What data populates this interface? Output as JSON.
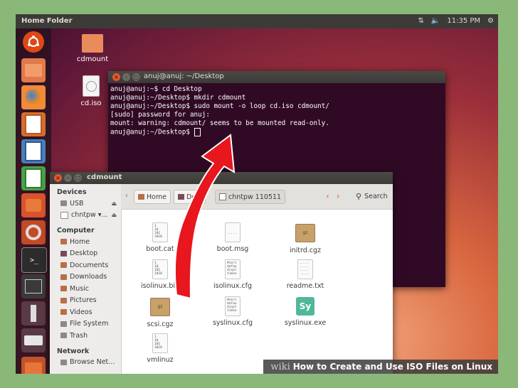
{
  "panel": {
    "title": "Home Folder",
    "clock": "11:35 PM"
  },
  "desktop_icons": [
    {
      "label": "cdmount"
    },
    {
      "label": "cd.iso"
    }
  ],
  "terminal": {
    "title": "anuj@anuj: ~/Desktop",
    "lines": [
      "anuj@anuj:~$ cd Desktop",
      "anuj@anuj:~/Desktop$ mkdir cdmount",
      "anuj@anuj:~/Desktop$ sudo mount -o loop cd.iso cdmount/",
      "[sudo] password for anuj:",
      "mount: warning: cdmount/ seems to be mounted read-only.",
      "anuj@anuj:~/Desktop$ "
    ]
  },
  "files_window": {
    "title": "cdmount",
    "sidebar": {
      "devices_heading": "Devices",
      "devices": [
        "USB",
        "chntpw ▾..."
      ],
      "computer_heading": "Computer",
      "computer": [
        "Home",
        "Desktop",
        "Documents",
        "Downloads",
        "Music",
        "Pictures",
        "Videos",
        "File System",
        "Trash"
      ],
      "network_heading": "Network",
      "network": [
        "Browse Net..."
      ]
    },
    "breadcrumbs": [
      "Home",
      "Desl",
      "chntpw 110511"
    ],
    "search_label": "Search",
    "files": [
      {
        "name": "boot.cat",
        "kind": "doc",
        "glyph": "1\n10\n101\n1010"
      },
      {
        "name": "boot.msg",
        "kind": "doc",
        "glyph": "\n\n.....\n"
      },
      {
        "name": "initrd.cgz",
        "kind": "box",
        "glyph": "gz"
      },
      {
        "name": "isolinux.bin",
        "kind": "doc",
        "glyph": "1\n10\n101\n1010"
      },
      {
        "name": "isolinux.cfg",
        "kind": "doc",
        "glyph": "#seri\ndefau\ndispl\ntimeo"
      },
      {
        "name": "readme.txt",
        "kind": "doc",
        "glyph": ".....\n.....\n.....\n....."
      },
      {
        "name": "scsi.cgz",
        "kind": "box",
        "glyph": "gz"
      },
      {
        "name": "syslinux.cfg",
        "kind": "doc",
        "glyph": "#seri\ndefau\ndispl\ntimeo"
      },
      {
        "name": "syslinux.exe",
        "kind": "exe",
        "glyph": "Sy"
      },
      {
        "name": "vmlinuz",
        "kind": "doc",
        "glyph": "1\n10\n101\n1010"
      }
    ]
  },
  "watermark": {
    "brand": "wiki",
    "text": "How to Create and Use ISO Files on Linux"
  },
  "colors": {
    "accent": "#e06a2c",
    "terminal_bg": "#300a24",
    "arrow": "#e8161d"
  }
}
